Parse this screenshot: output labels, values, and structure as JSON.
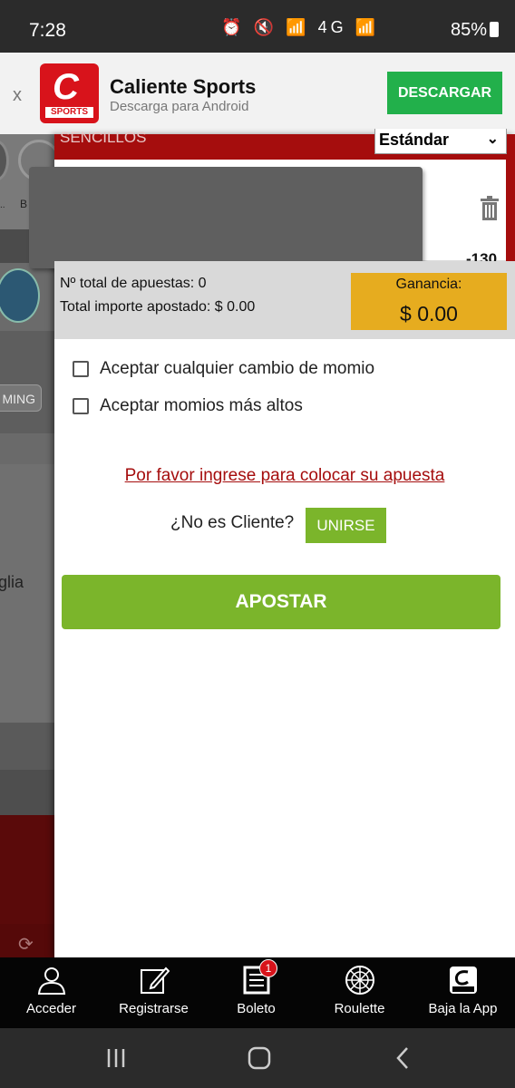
{
  "status_bar": {
    "time": "7:28",
    "icons": "⏰ 🔇 📶 4G 📶",
    "battery": "85%"
  },
  "banner": {
    "close_label": "x",
    "logo_letter": "C",
    "logo_text": "SPORTS",
    "title": "Caliente Sports",
    "subtitle": "Descarga para Android",
    "download_label": "DESCARGAR"
  },
  "background_page": {
    "avatar_label_1": "..",
    "avatar_label_2": "B",
    "gaming_label": "MING",
    "side_text": "glia"
  },
  "slip": {
    "header_label": "SENCILLOS",
    "type_selected": "Estándar",
    "bet_odds": "-130",
    "count_label": "Nº total de apuestas: 0",
    "total_label": "Total importe apostado: $ 0.00",
    "gain_label": "Ganancia:",
    "gain_value": "$ 0.00",
    "options": [
      {
        "label": "Aceptar cualquier cambio de momio",
        "checked": false
      },
      {
        "label": "Aceptar momios más altos",
        "checked": false
      }
    ],
    "login_link": "Por favor ingrese para colocar su apuesta",
    "not_client": "¿No es Cliente?",
    "join_label": "UNIRSE",
    "bet_label": "APOSTAR"
  },
  "bottom_nav": {
    "items": [
      {
        "label": "Acceder",
        "icon": "user-icon"
      },
      {
        "label": "Registrarse",
        "icon": "edit-icon"
      },
      {
        "label": "Boleto",
        "icon": "ticket-icon"
      },
      {
        "label": "Roulette",
        "icon": "roulette-icon"
      },
      {
        "label": "Baja la App",
        "icon": "app-logo-icon"
      }
    ],
    "badge_count": "1"
  },
  "colors": {
    "brand_red": "#a50d0d",
    "accent_green": "#7bb52b",
    "gain_yellow": "#e6ac1f",
    "download_green": "#22b04b"
  }
}
